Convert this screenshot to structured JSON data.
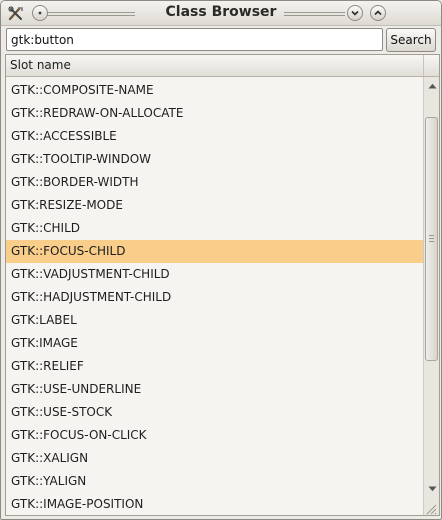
{
  "window": {
    "title": "Class Browser"
  },
  "titlebar": {
    "icons": [
      "tools-icon",
      "window-menu-icon",
      "minimize-icon",
      "maximize-icon"
    ]
  },
  "search": {
    "value": "gtk:button",
    "button_label": "Search"
  },
  "list": {
    "column_header": "Slot name",
    "selected_index": 7,
    "selection_color": "#f9cd8a",
    "items": [
      "GTK::COMPOSITE-NAME",
      "GTK::REDRAW-ON-ALLOCATE",
      "GTK::ACCESSIBLE",
      "GTK::TOOLTIP-WINDOW",
      "GTK::BORDER-WIDTH",
      "GTK:RESIZE-MODE",
      "GTK::CHILD",
      "GTK::FOCUS-CHILD",
      "GTK::VADJUSTMENT-CHILD",
      "GTK::HADJUSTMENT-CHILD",
      "GTK:LABEL",
      "GTK:IMAGE",
      "GTK::RELIEF",
      "GTK::USE-UNDERLINE",
      "GTK::USE-STOCK",
      "GTK::FOCUS-ON-CLICK",
      "GTK::XALIGN",
      "GTK::YALIGN",
      "GTK::IMAGE-POSITION"
    ]
  }
}
